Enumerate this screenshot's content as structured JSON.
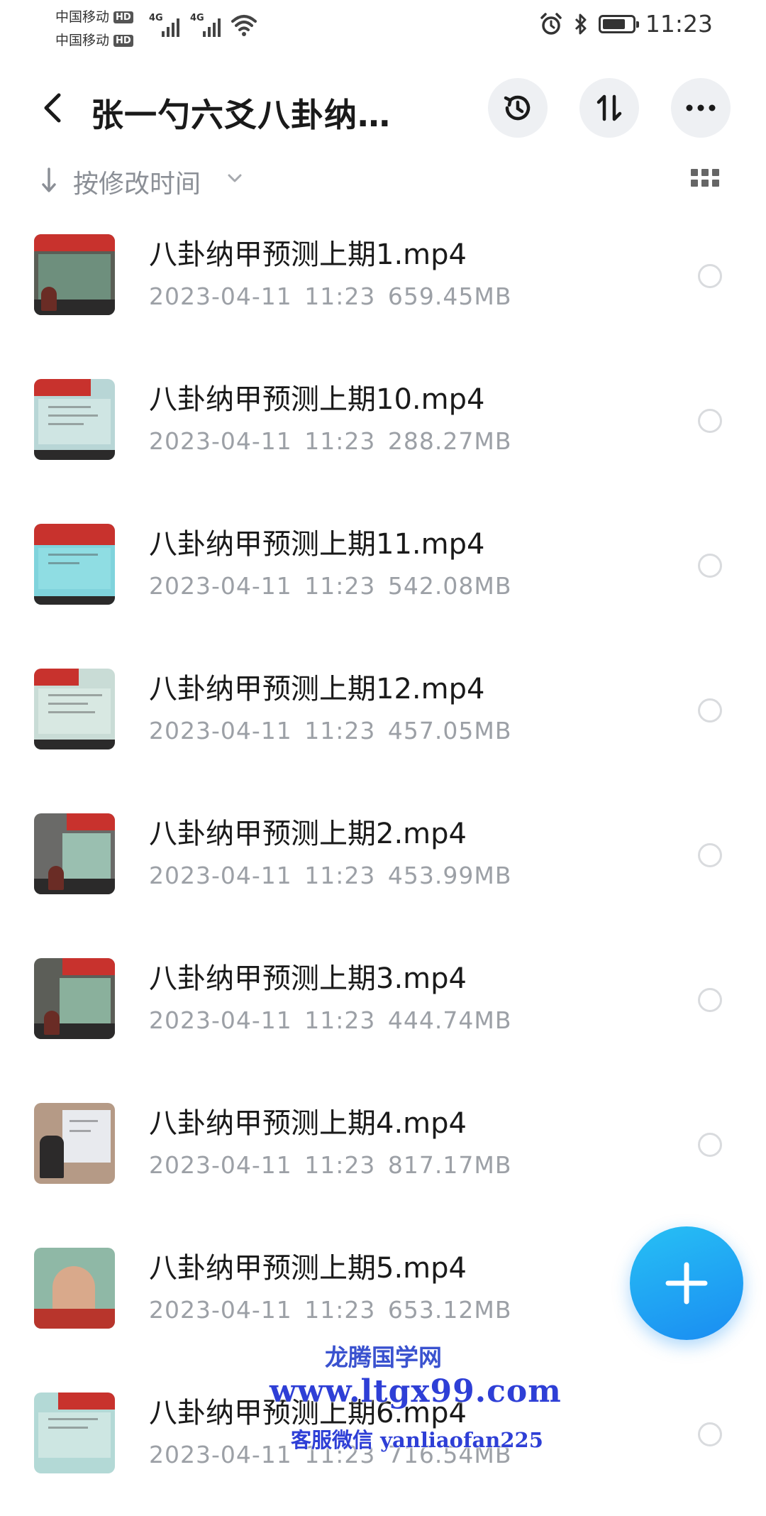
{
  "status_bar": {
    "carrier_1": "中国移动",
    "carrier_2": "中国移动",
    "hd_badge": "HD",
    "network_1": "4G",
    "network_2": "4G",
    "time": "11:23"
  },
  "header": {
    "title": "张一勺六爻八卦纳…",
    "icons": [
      "back-arrow",
      "history-clock",
      "sort-updown",
      "more-dots"
    ]
  },
  "sort": {
    "label": "按修改时间",
    "view_icon": "grid-view"
  },
  "files": [
    {
      "name": "八卦纳甲预测上期1.mp4",
      "date": "2023-04-11",
      "time": "11:23",
      "size": "659.45MB"
    },
    {
      "name": "八卦纳甲预测上期10.mp4",
      "date": "2023-04-11",
      "time": "11:23",
      "size": "288.27MB"
    },
    {
      "name": "八卦纳甲预测上期11.mp4",
      "date": "2023-04-11",
      "time": "11:23",
      "size": "542.08MB"
    },
    {
      "name": "八卦纳甲预测上期12.mp4",
      "date": "2023-04-11",
      "time": "11:23",
      "size": "457.05MB"
    },
    {
      "name": "八卦纳甲预测上期2.mp4",
      "date": "2023-04-11",
      "time": "11:23",
      "size": "453.99MB"
    },
    {
      "name": "八卦纳甲预测上期3.mp4",
      "date": "2023-04-11",
      "time": "11:23",
      "size": "444.74MB"
    },
    {
      "name": "八卦纳甲预测上期4.mp4",
      "date": "2023-04-11",
      "time": "11:23",
      "size": "817.17MB"
    },
    {
      "name": "八卦纳甲预测上期5.mp4",
      "date": "2023-04-11",
      "time": "11:23",
      "size": "653.12MB"
    },
    {
      "name": "八卦纳甲预测上期6.mp4",
      "date": "2023-04-11",
      "time": "11:23",
      "size": "716.54MB"
    }
  ],
  "fab": {
    "icon": "plus-icon",
    "color": "#1aa3f5"
  },
  "watermark": {
    "line1": "龙腾国学网",
    "line2": "www.ltgx99.com",
    "line3": "客服微信 yanliaofan225"
  }
}
